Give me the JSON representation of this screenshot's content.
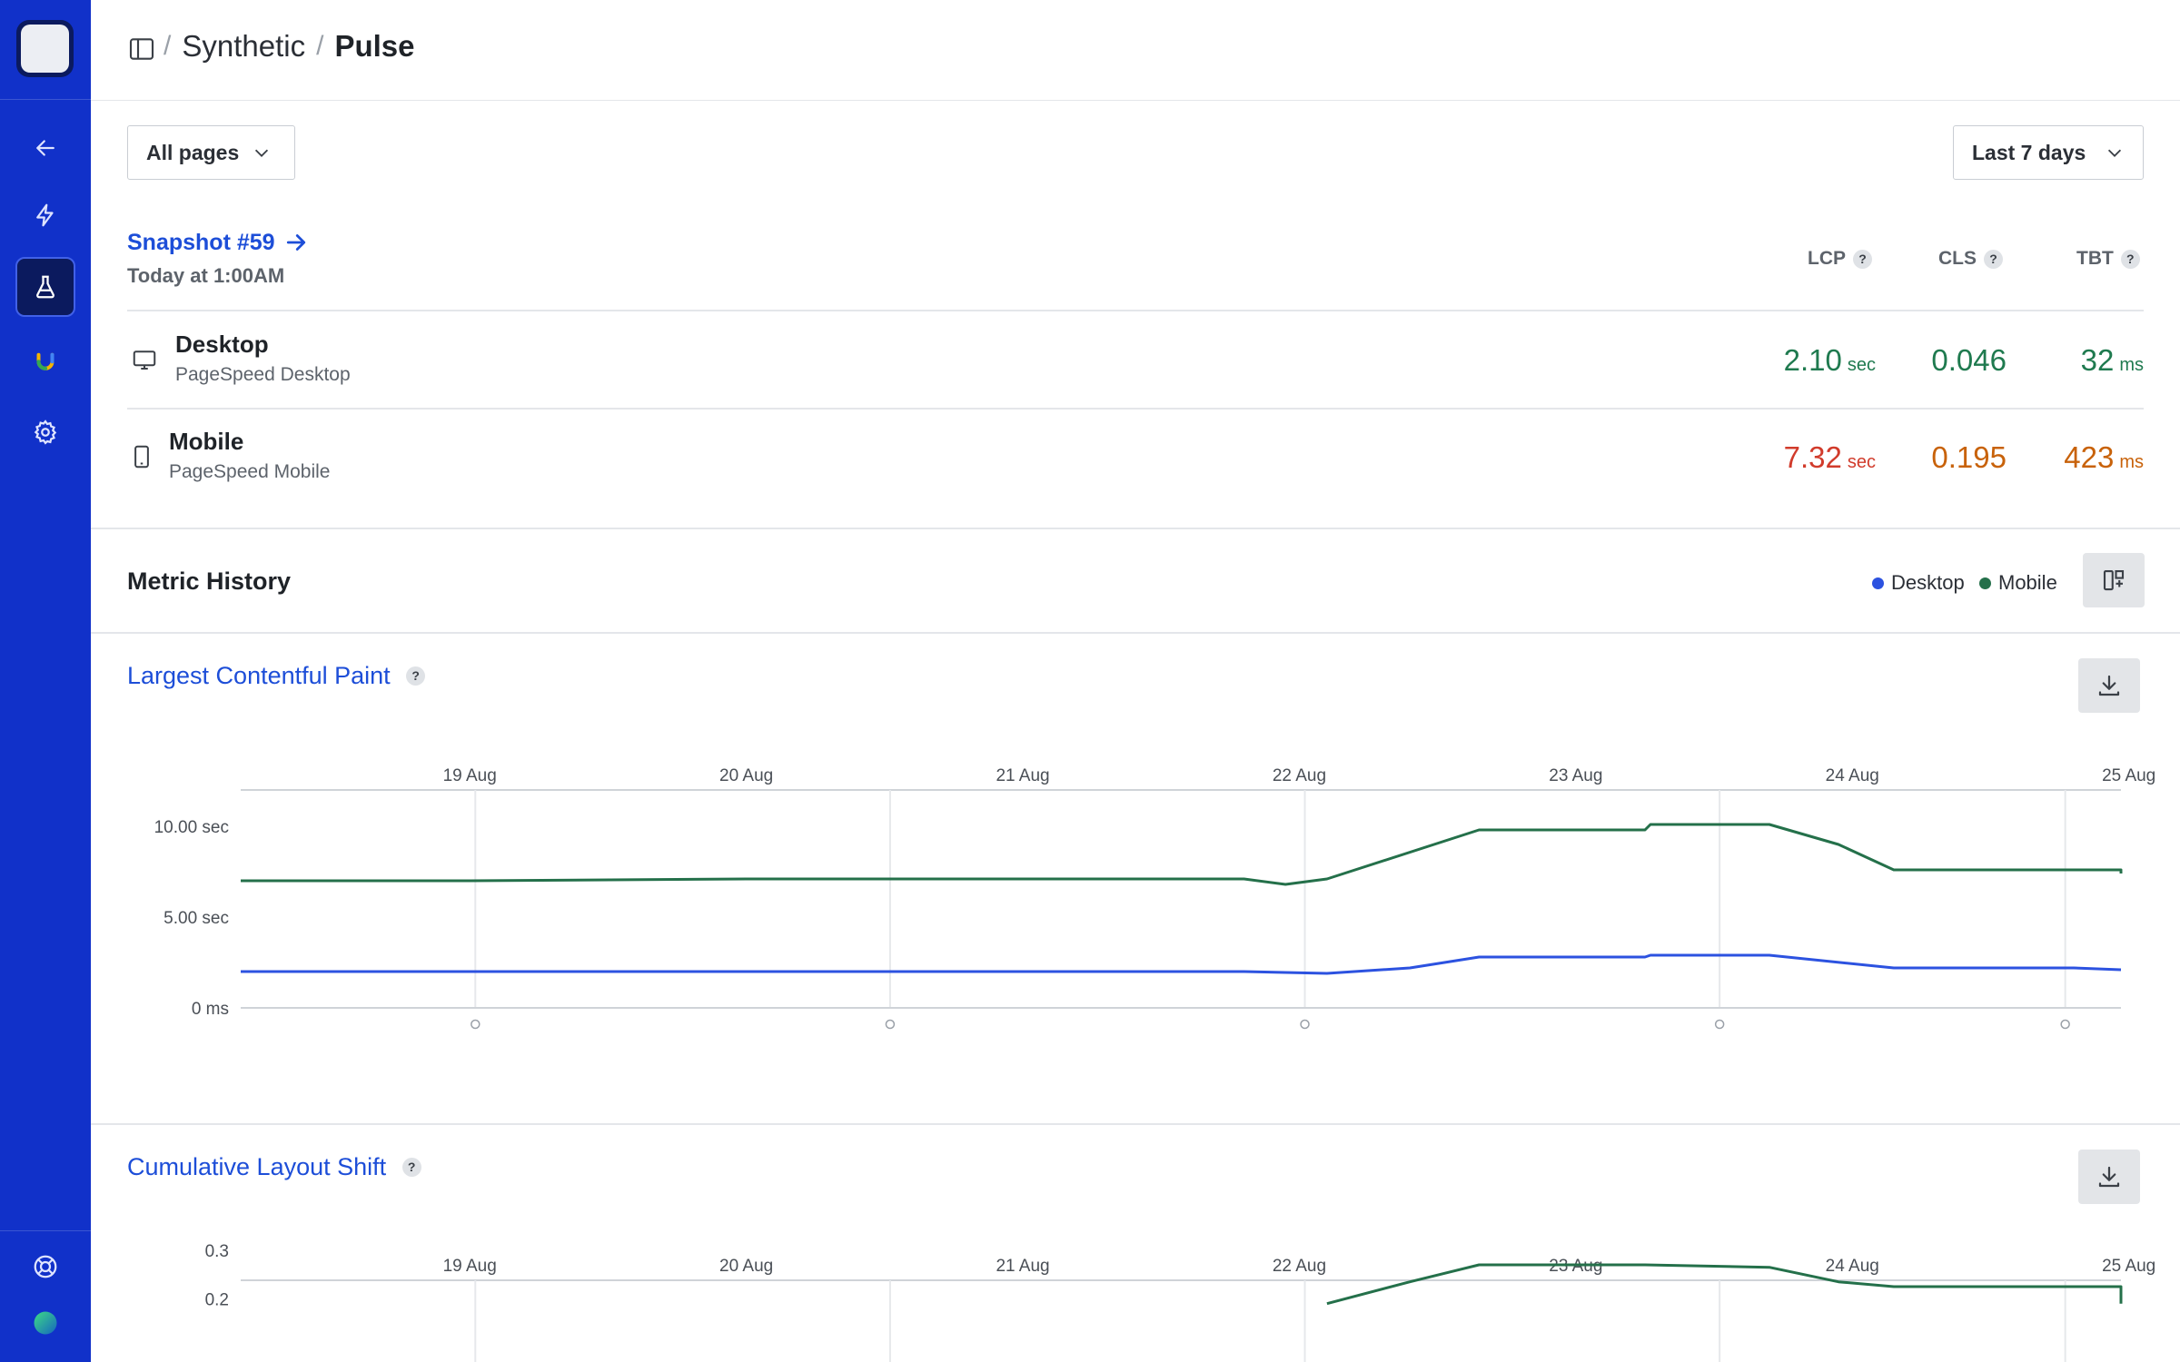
{
  "breadcrumb": {
    "parent": "Synthetic",
    "separator": "/",
    "current": "Pulse"
  },
  "filters": {
    "pages": "All pages",
    "range": "Last 7 days"
  },
  "snapshot": {
    "link": "Snapshot #59",
    "date": "Today at 1:00AM"
  },
  "columns": [
    "LCP",
    "CLS",
    "TBT"
  ],
  "help_glyph": "?",
  "devices": [
    {
      "name": "Desktop",
      "sub": "PageSpeed Desktop",
      "lcp": "2.10",
      "lcp_unit": "sec",
      "cls": "0.046",
      "tbt": "32",
      "tbt_unit": "ms",
      "status": [
        "good",
        "good",
        "good"
      ]
    },
    {
      "name": "Mobile",
      "sub": "PageSpeed Mobile",
      "lcp": "7.32",
      "lcp_unit": "sec",
      "cls": "0.195",
      "tbt": "423",
      "tbt_unit": "ms",
      "status": [
        "bad",
        "warn",
        "warn"
      ]
    }
  ],
  "colors": {
    "sidebar": "#1131c9",
    "link": "#1d4ed8",
    "good": "#1f7a4f",
    "bad": "#d13b2b",
    "warn": "#c8620a",
    "desktop_series": "#2c52e0",
    "mobile_series": "#24704a"
  },
  "history": {
    "title": "Metric History",
    "legend": [
      "Desktop",
      "Mobile"
    ]
  },
  "chart_data": [
    {
      "type": "line",
      "title": "Largest Contentful Paint",
      "x_tick_labels": [
        "19 Aug",
        "20 Aug",
        "21 Aug",
        "22 Aug",
        "23 Aug",
        "24 Aug",
        "25 Aug"
      ],
      "y_tick_labels": [
        "10.00 sec",
        "5.00 sec",
        "0 ms"
      ],
      "y_ticks": [
        10,
        5,
        0
      ],
      "ylim": [
        0,
        12
      ],
      "xlim": [
        0,
        6.8
      ],
      "x_grid": [
        0.52,
        2.02,
        3.52,
        5.02,
        6.27
      ],
      "series": [
        {
          "name": "Desktop",
          "points": [
            [
              -0.33,
              2.0
            ],
            [
              0.5,
              2.0
            ],
            [
              1.5,
              2.0
            ],
            [
              2.5,
              2.0
            ],
            [
              3.3,
              2.0
            ],
            [
              3.6,
              1.9
            ],
            [
              3.9,
              2.2
            ],
            [
              4.15,
              2.8
            ],
            [
              4.75,
              2.8
            ],
            [
              4.77,
              2.9
            ],
            [
              5.2,
              2.9
            ],
            [
              5.65,
              2.2
            ],
            [
              6.3,
              2.2
            ],
            [
              6.7,
              2.1
            ]
          ]
        },
        {
          "name": "Mobile",
          "points": [
            [
              -0.33,
              7.0
            ],
            [
              0.5,
              7.0
            ],
            [
              1.5,
              7.1
            ],
            [
              2.5,
              7.1
            ],
            [
              3.3,
              7.1
            ],
            [
              3.45,
              6.8
            ],
            [
              3.6,
              7.1
            ],
            [
              4.15,
              9.8
            ],
            [
              4.75,
              9.8
            ],
            [
              4.77,
              10.1
            ],
            [
              5.2,
              10.1
            ],
            [
              5.45,
              9.0
            ],
            [
              5.65,
              7.6
            ],
            [
              6.3,
              7.6
            ],
            [
              6.5,
              7.6
            ],
            [
              6.7,
              7.4
            ]
          ]
        }
      ]
    },
    {
      "type": "line",
      "title": "Cumulative Layout Shift",
      "x_tick_labels": [
        "19 Aug",
        "20 Aug",
        "21 Aug",
        "22 Aug",
        "23 Aug",
        "24 Aug",
        "25 Aug"
      ],
      "y_tick_labels": [
        "0.3",
        "0.2"
      ],
      "y_ticks": [
        0.3,
        0.2
      ],
      "ylim": [
        0,
        0.36
      ],
      "xlim": [
        0,
        6.8
      ],
      "x_grid": [
        0.52,
        2.02,
        3.52,
        5.02,
        6.27
      ],
      "series": [
        {
          "name": "Desktop",
          "points": []
        },
        {
          "name": "Mobile",
          "points": [
            [
              3.6,
              0.19
            ],
            [
              3.9,
              0.235
            ],
            [
              4.15,
              0.27
            ],
            [
              4.75,
              0.27
            ],
            [
              5.2,
              0.265
            ],
            [
              5.45,
              0.235
            ],
            [
              5.65,
              0.225
            ],
            [
              6.3,
              0.225
            ],
            [
              6.5,
              0.225
            ],
            [
              6.7,
              0.19
            ]
          ]
        }
      ]
    }
  ]
}
